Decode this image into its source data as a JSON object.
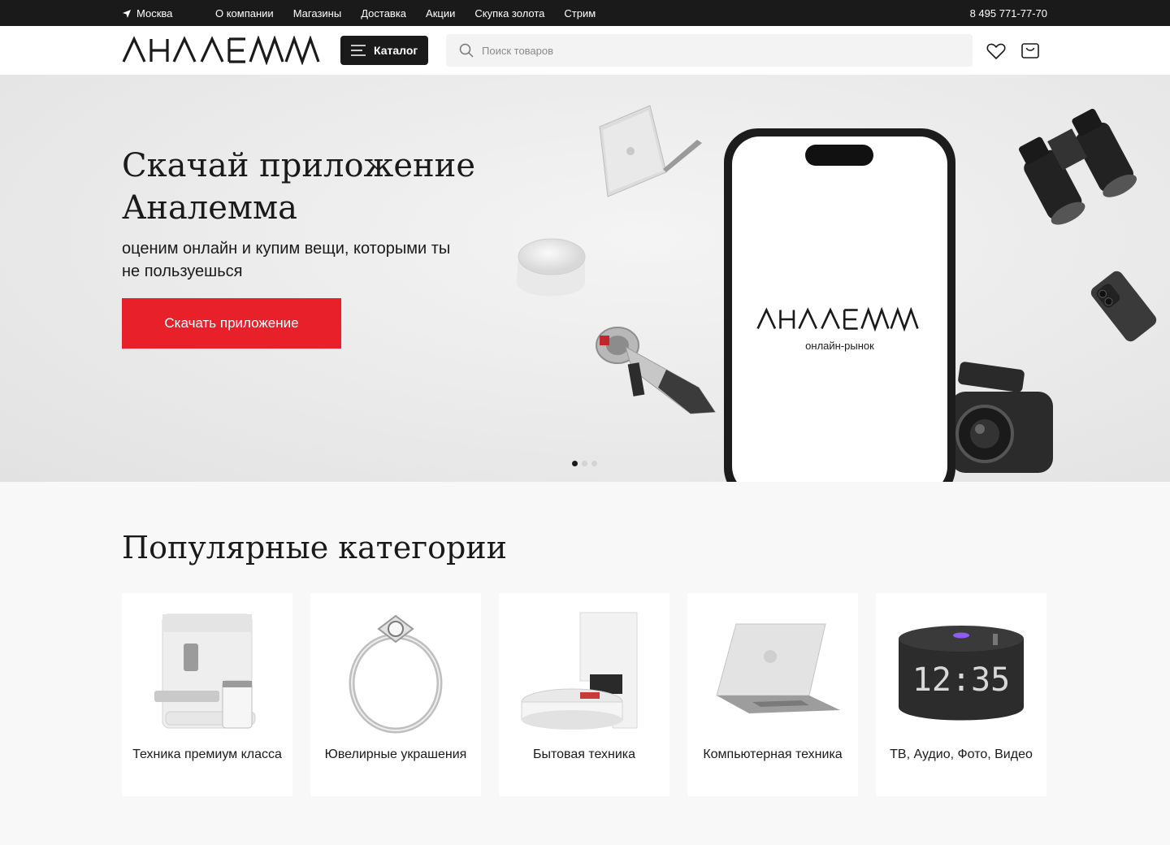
{
  "topbar": {
    "city": "Москва",
    "nav": [
      "О компании",
      "Магазины",
      "Доставка",
      "Акции",
      "Скупка золота",
      "Стрим"
    ],
    "phone": "8 495 771-77-70"
  },
  "header": {
    "logo_text": "АНАЛЕММА",
    "catalog_label": "Каталог",
    "search_placeholder": "Поиск товаров",
    "icons": [
      "heart-icon",
      "cart-icon"
    ]
  },
  "hero": {
    "title": "Скачай приложение Аналемма",
    "subtitle": "оценим онлайн и купим вещи, которыми ты не пользуешься",
    "button_label": "Скачать приложение",
    "phone_logo": "АНАЛЕММА",
    "phone_tagline": "онлайн-рынок",
    "slides_count": 3,
    "active_slide": 1,
    "accent_color": "#e8202a"
  },
  "categories": {
    "title": "Популярные категории",
    "items": [
      {
        "label": "Техника премиум класса",
        "icon": "coffee-machine"
      },
      {
        "label": "Ювелирные украшения",
        "icon": "ring"
      },
      {
        "label": "Бытовая техника",
        "icon": "robot-vacuum"
      },
      {
        "label": "Компьютерная техника",
        "icon": "laptop"
      },
      {
        "label": "ТВ, Аудио, Фото, Видео",
        "icon": "smart-speaker-clock",
        "clock": "12:35"
      }
    ]
  }
}
